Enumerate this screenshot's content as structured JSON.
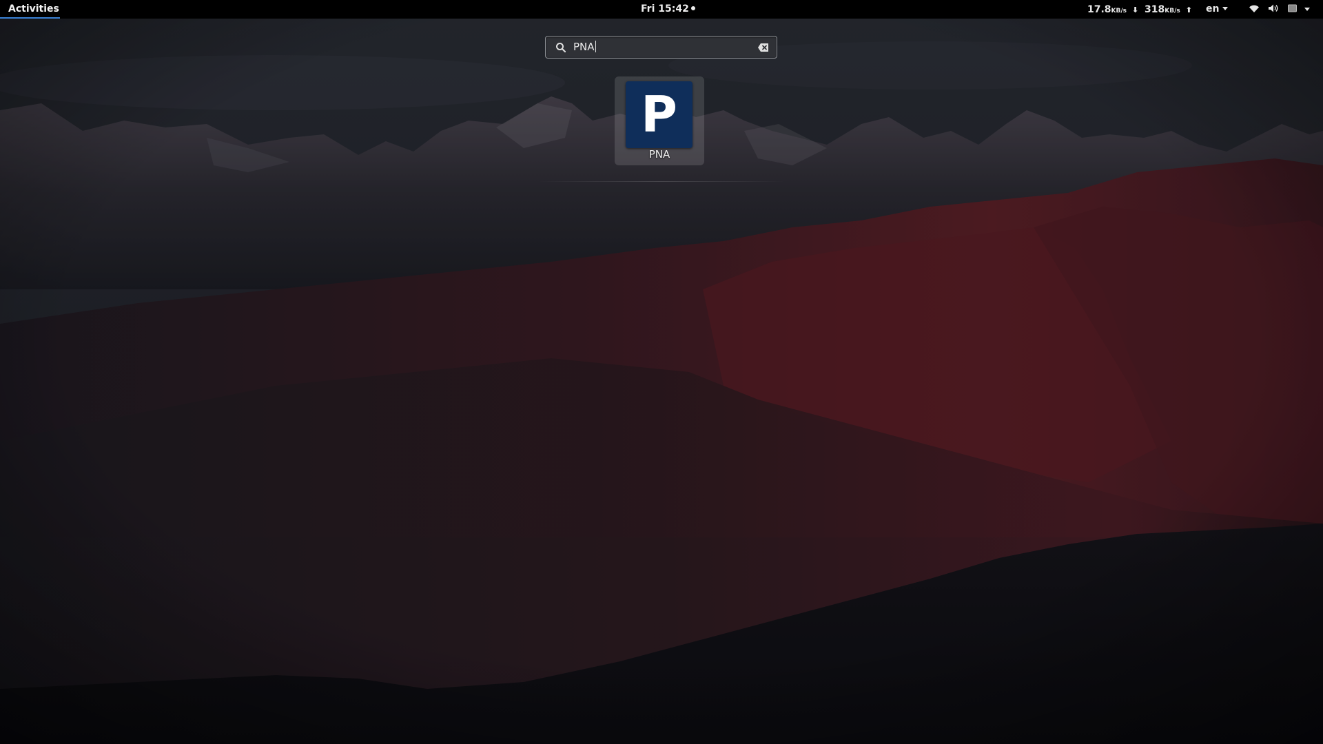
{
  "topbar": {
    "activities_label": "Activities",
    "clock": "Fri 15:42",
    "net_down": {
      "value": "17.8",
      "unit": "KB/s",
      "arrow": "⬇"
    },
    "net_up": {
      "value": "318",
      "unit": "KB/s",
      "arrow": "⬆"
    },
    "language": "en",
    "icons": [
      "wifi-icon",
      "volume-icon",
      "battery-icon",
      "system-menu-chevron-icon"
    ]
  },
  "search": {
    "query": "PNA",
    "icons": [
      "search-icon",
      "clear-icon"
    ]
  },
  "results": [
    {
      "icon_letter": "P",
      "label": "PNA"
    }
  ],
  "colors": {
    "topbar_bg": "#000000",
    "accent": "#3a82d6",
    "app_icon_bg": "#0f2e5a"
  }
}
